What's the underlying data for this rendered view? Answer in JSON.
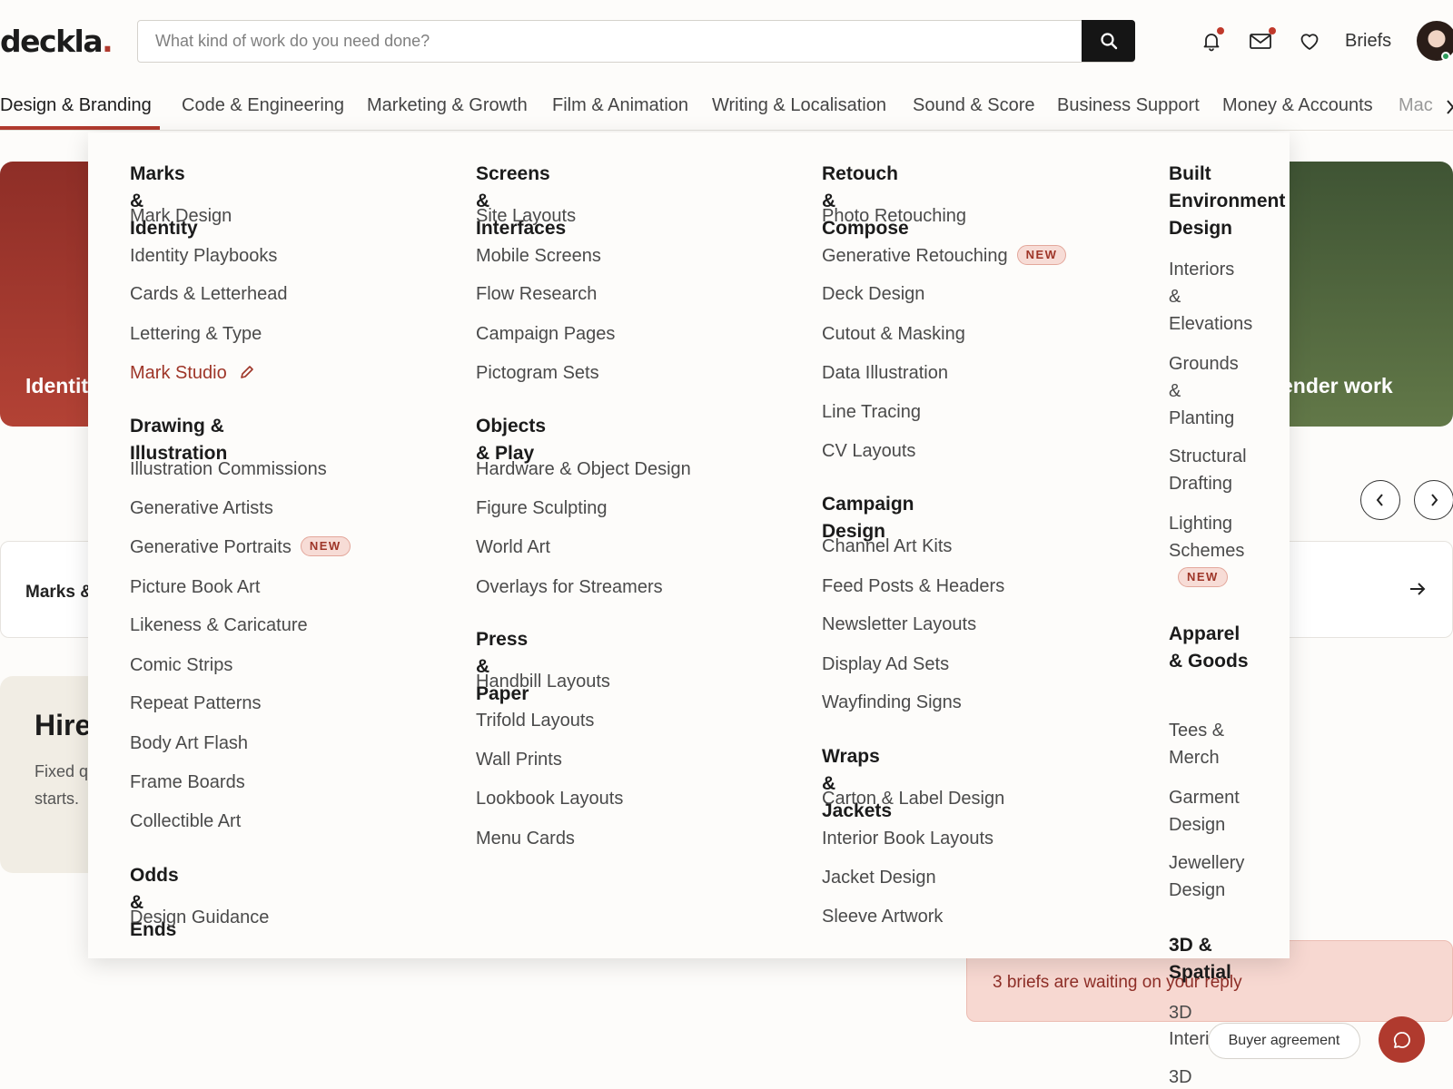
{
  "header": {
    "logo": "deckla",
    "logo_dot": ".",
    "search_placeholder": "What kind of work do you need done?",
    "briefs_label": "Briefs"
  },
  "categories": [
    "Design & Branding",
    "Code & Engineering",
    "Marketing & Growth",
    "Film & Animation",
    "Writing & Localisation",
    "Sound & Score",
    "Business Support",
    "Money & Accounts",
    "Mac"
  ],
  "background": {
    "card_red_label": "Identit",
    "card_green_label": "ender work",
    "row_card_label": "Marks &",
    "hire_title": "Hire",
    "hire_sub_1": "Fixed q",
    "hire_sub_2": "starts.",
    "notice": "3 briefs are waiting on your reply",
    "agreement": "Buyer agreement"
  },
  "menu": {
    "badge_new": "NEW",
    "col1": {
      "h1": "Marks & Identity",
      "g1": [
        "Mark Design",
        "Identity Playbooks",
        "Cards & Letterhead",
        "Lettering & Type"
      ],
      "studio": "Mark Studio",
      "h2": "Drawing & Illustration",
      "g2": [
        "Illustration Commissions",
        "Generative Artists",
        "Generative Portraits",
        "Picture Book Art",
        "Likeness & Caricature",
        "Comic Strips",
        "Repeat Patterns",
        "Body Art Flash",
        "Frame Boards",
        "Collectible Art"
      ],
      "h3": "Odds & Ends",
      "g3": [
        "Design Guidance"
      ]
    },
    "col2": {
      "h1": "Screens & Interfaces",
      "g1": [
        "Site Layouts",
        "Mobile Screens",
        "Flow Research",
        "Campaign Pages",
        "Pictogram Sets"
      ],
      "h2": "Objects & Play",
      "g2": [
        "Hardware & Object Design",
        "Figure Sculpting",
        "World Art",
        "Overlays for Streamers"
      ],
      "h3": "Press & Paper",
      "g3": [
        "Handbill Layouts",
        "Trifold Layouts",
        "Wall Prints",
        "Lookbook Layouts",
        "Menu Cards"
      ]
    },
    "col3": {
      "h1": "Retouch & Compose",
      "g1": [
        "Photo Retouching",
        "Generative Retouching",
        "Deck Design",
        "Cutout & Masking",
        "Data Illustration",
        "Line Tracing",
        "CV Layouts"
      ],
      "h2": "Campaign Design",
      "g2": [
        "Channel Art Kits",
        "Feed Posts & Headers",
        "Newsletter Layouts",
        "Display Ad Sets",
        "Wayfinding Signs"
      ],
      "h3": "Wraps & Jackets",
      "g3": [
        "Carton & Label Design",
        "Interior Book Layouts",
        "Jacket Design",
        "Sleeve Artwork"
      ]
    },
    "col4": {
      "h1": "Built Environment Design",
      "g1": [
        "Interiors & Elevations",
        "Grounds & Planting",
        "Structural Drafting",
        "Lighting Schemes"
      ],
      "h2": "Apparel & Goods",
      "g2": [
        "Tees & Merch",
        "Garment Design",
        "Jewellery Design"
      ],
      "h3": "3D & Spatial",
      "g3": [
        "3D",
        "Interi",
        "3D"
      ]
    }
  }
}
